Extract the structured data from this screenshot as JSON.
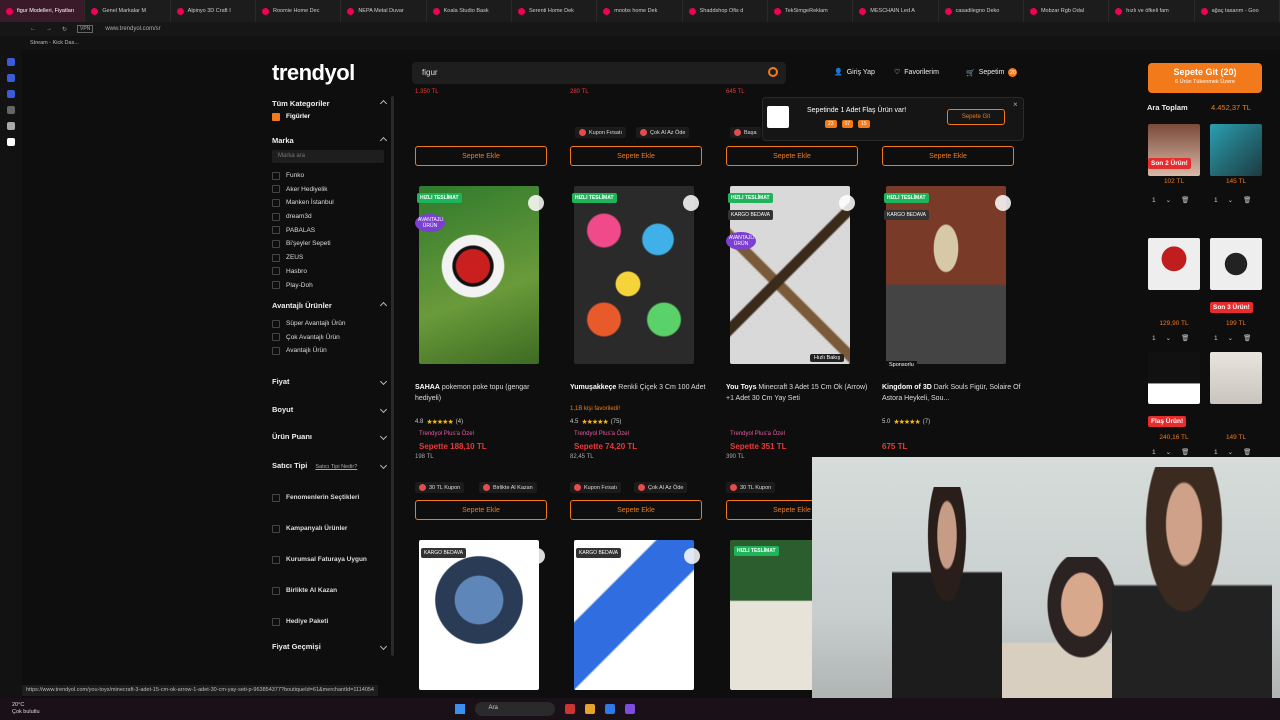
{
  "browser": {
    "tabs": [
      "figur Modelleri, Fiyatları",
      "Genel Markalar M",
      "Alpinyo 3D Craft I",
      "Roomie Home Dec",
      "NEPA Metal Duvar",
      "Koala Studio Bask",
      "Serenti Home Dek",
      "moobs home Dek",
      "Shaddshop Ofis d",
      "TekSimgeReklam",
      "MESCHAIN Led A",
      "casadilegno Deko",
      "Mobzar Rgb Odal",
      "hızlı ve öfkeli fam",
      "ağaç tasarım - Goo"
    ],
    "vpn_label": "VPN",
    "url": "www.trendyol.com/sr",
    "bookmark": "Stream - Kick Das..."
  },
  "header": {
    "logo": "trendyol",
    "search_value": "figur",
    "login_label": "Giriş Yap",
    "favorites_label": "Favorilerim",
    "cart_label": "Sepetim",
    "cart_count": "20"
  },
  "filters": {
    "categories_title": "Tüm Kategoriler",
    "category_item": "Figürler",
    "brand_title": "Marka",
    "brand_search_placeholder": "Marka ara",
    "brands": [
      "Funko",
      "Aker Hediyelik",
      "Manken İstanbul",
      "dream3d",
      "PABALAS",
      "Bi'şeyler Sepeti",
      "ZEUS",
      "Hasbro",
      "Play-Doh"
    ],
    "advantaged_title": "Avantajlı Ürünler",
    "advantaged_items": [
      "Süper Avantajlı Ürün",
      "Çok Avantajlı Ürün",
      "Avantajlı Ürün"
    ],
    "collapsed": [
      "Fiyat",
      "Boyut",
      "Ürün Puanı"
    ],
    "seller_type": "Satıcı Tipi",
    "seller_type_link": "Satıcı Tipi Nedir?",
    "seller_options": [
      "Fenomenlerin Seçtikleri",
      "Kampanyalı Ürünler",
      "Kurumsal Faturaya Uygun",
      "Birlikte Al Kazan",
      "Hediye Paketi"
    ],
    "price_compare": "Fiyat Geçmişi"
  },
  "top_row": {
    "prices": [
      "1.350 TL",
      "280 TL",
      "645 TL"
    ],
    "chips": [
      "Kupon Fırsatı",
      "Çok Al Az Öde",
      "Başa"
    ],
    "add_label": "Sepete Ekle"
  },
  "products": [
    {
      "brand": "SAHAA",
      "name": "pokemon poke topu (gengar hediyeli)",
      "rating": "4.8",
      "reviews": "(4)",
      "fav": "",
      "plus": "Trendyol Plus'a Özel",
      "basket_price": "Sepette 188,10 TL",
      "old_price": "198 TL",
      "chips": [
        "30 TL Kupon",
        "Birlikte Al Kazan"
      ],
      "badge": "HIZLI TESLİMAT",
      "adv": "AVANTAJLI ÜRÜN"
    },
    {
      "brand": "Yumuşakkeçe",
      "name": "Renkli Çiçek 3 Cm 100 Adet",
      "rating": "4.5",
      "reviews": "(75)",
      "fav": "1,1B kişi favoriledi!",
      "plus": "Trendyol Plus'a Özel",
      "basket_price": "Sepette 74,20 TL",
      "old_price": "82,45 TL",
      "chips": [
        "Kupon Fırsatı",
        "Çok Al Az Öde"
      ],
      "badge": "HIZLI TESLİMAT",
      "adv": ""
    },
    {
      "brand": "You Toys",
      "name": "Minecraft 3 Adet 15 Cm Ok (Arrow) +1 Adet 30 Cm Yay Seti",
      "rating": "",
      "reviews": "",
      "fav": "",
      "plus": "Trendyol Plus'a Özel",
      "basket_price": "Sepette 351 TL",
      "old_price": "390 TL",
      "chips": [
        "30 TL Kupon"
      ],
      "badge": "HIZLI TESLİMAT",
      "adv": "AVANTAJLI ÜRÜN",
      "quick": "Hızlı Bakış"
    },
    {
      "brand": "Kingdom of 3D",
      "name": "Dark Souls Figür, Solaire Of Astora Heykeli, Sou...",
      "rating": "5.0",
      "reviews": "(7)",
      "fav": "",
      "plus": "",
      "basket_price": "",
      "old_price": "675 TL",
      "chips": [],
      "badge": "HIZLI TESLİMAT",
      "adv": "",
      "sponsor": "Sponsorlu"
    }
  ],
  "bottom_badges": [
    "KARGO BEDAVA",
    "KARGO BEDAVA",
    "HIZLI TESLİMAT"
  ],
  "popup": {
    "text": "Sepetinde 1 Adet Flaş Ürün var!",
    "timer": [
      "23",
      "07",
      "15"
    ],
    "button": "Sepete Git"
  },
  "cart_panel": {
    "go_label": "Sepete Git (20)",
    "go_sub": "6 Ürün Tükenmek Üzere",
    "total_label": "Ara Toplam",
    "total_value": "4.452,37 TL",
    "items": [
      {
        "price": "102 TL",
        "tag": "Son 2 Ürün!",
        "qty": "1"
      },
      {
        "price": "145 TL",
        "tag": "",
        "qty": "1"
      },
      {
        "price": "129,90 TL",
        "tag": "",
        "qty": "1"
      },
      {
        "price": "199 TL",
        "tag": "Son 3 Ürün!",
        "qty": "1"
      },
      {
        "price": "240,16 TL",
        "tag": "Flaş Ürün!",
        "qty": "1"
      },
      {
        "price": "149 TL",
        "tag": "",
        "qty": "1"
      }
    ]
  },
  "status_url": "https://www.trendyol.com/you-toys/minecraft-3-adet-15-cm-ok-arrow-1-adet-30-cm-yay-seti-p-963854377?boutiqueId=61&merchantId=1114054",
  "taskbar": {
    "search": "Ara",
    "weather": "20°C",
    "weather_sub": "Çok bulutlu"
  },
  "colors": {
    "accent": "#f27a1a",
    "price_red": "#e73a3a",
    "green_badge": "#1fb45a"
  }
}
